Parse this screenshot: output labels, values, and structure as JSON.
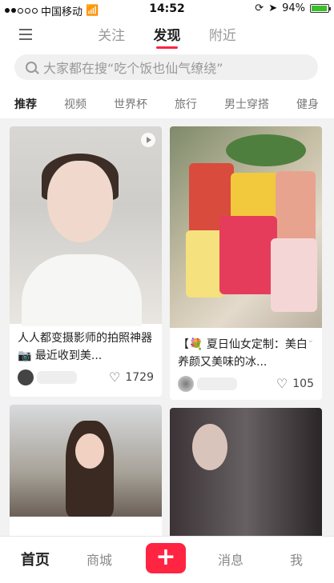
{
  "status_bar": {
    "carrier": "中国移动",
    "time": "14:52",
    "battery": "94%",
    "battery_level": 0.94
  },
  "top_nav": {
    "tabs": [
      {
        "label": "关注"
      },
      {
        "label": "发现"
      },
      {
        "label": "附近"
      }
    ],
    "active_tab": "发现"
  },
  "search": {
    "placeholder": "大家都在搜“吃个饭也仙气缭绕”"
  },
  "categories": [
    "推荐",
    "视频",
    "世界杯",
    "旅行",
    "男士穿搭",
    "健身"
  ],
  "feed": {
    "cards": [
      {
        "title": "人人都变摄影师的拍照神器📷 最近收到美...",
        "likes": "1729"
      },
      {
        "title": "【💐 夏日仙女定制：美白养颜又美味的冰...",
        "likes": "105"
      }
    ]
  },
  "bottom_nav": {
    "home": "首页",
    "mall": "商城",
    "add": "+",
    "messages": "消息",
    "me": "我"
  },
  "colors": {
    "accent": "#ff2442",
    "background": "#f2f2f2"
  }
}
